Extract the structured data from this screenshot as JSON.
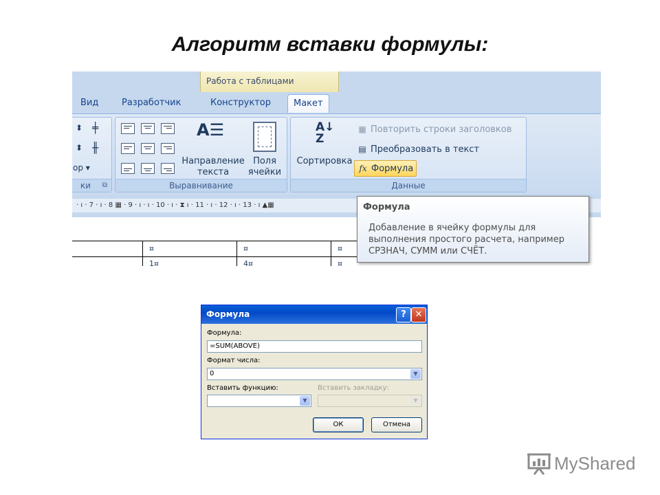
{
  "slide": {
    "title": "Алгоритм вставки формулы:"
  },
  "ribbon": {
    "contextual_group": "Работа с таблицами",
    "tabs": [
      {
        "label": "Вид"
      },
      {
        "label": "Разработчик"
      },
      {
        "label": "Конструктор"
      },
      {
        "label": "Макет",
        "active": true
      }
    ],
    "left_partial": {
      "dropdown_label": "ор",
      "group_label": "ки"
    },
    "alignment_group": {
      "label": "Выравнивание",
      "text_direction_label": "Направление текста",
      "margins_label": "Поля ячейки"
    },
    "data_group": {
      "label": "Данные",
      "sort_label": "Сортировка",
      "commands": [
        {
          "label": "Повторить строки заголовков",
          "disabled": true
        },
        {
          "label": "Преобразовать в текст"
        },
        {
          "label": "Формула",
          "highlight": true
        }
      ]
    },
    "ruler_numbers": [
      "7",
      "8",
      "9",
      "10",
      "11",
      "12",
      "13"
    ]
  },
  "tooltip": {
    "title": "Формула",
    "description": "Добавление в ячейку формулы для выполнения простого расчета, например СРЗНАЧ, СУММ или СЧЁТ."
  },
  "document_table": {
    "cells": [
      "¤",
      "¤",
      "¤",
      "1¤",
      "4¤",
      "¤"
    ]
  },
  "dialog": {
    "title": "Формула",
    "help_glyph": "?",
    "close_glyph": "✕",
    "formula_label": "Формула:",
    "formula_value": "=SUM(ABOVE)",
    "number_format_label": "Формат числа:",
    "number_format_value": "0",
    "insert_function_label": "Вставить функцию:",
    "insert_bookmark_label": "Вставить закладку:",
    "ok_label": "ОК",
    "cancel_label": "Отмена"
  },
  "logo": {
    "text": "MyShared"
  },
  "colors": {
    "ribbon_blue": "#c5d8ee",
    "dialog_titlebar": "#0349c7",
    "highlight": "#ffd65c"
  }
}
